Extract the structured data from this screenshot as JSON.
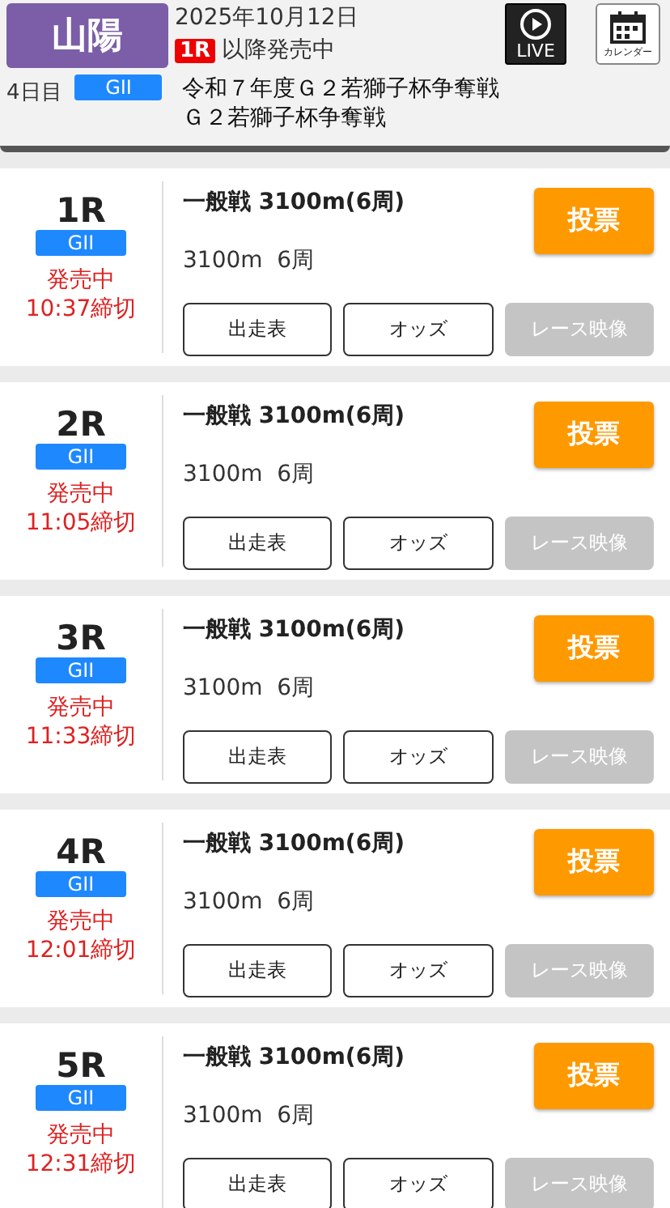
{
  "header": {
    "venue": "山陽",
    "date": "2025年10月12日",
    "start_race": "1R",
    "sale_status": "以降発売中",
    "day": "4日目",
    "grade": "GII",
    "title_lines": [
      "令和７年度Ｇ２若獅子杯争奪戦",
      "Ｇ２若獅子杯争奪戦"
    ],
    "live_label": "LIVE",
    "calendar_label": "カレンダー"
  },
  "races": [
    {
      "number": "1R",
      "grade": "GII",
      "status": "発売中",
      "deadline": "10:37締切",
      "name": "一般戦 3100m(6周)",
      "distance": "3100m  6周",
      "vote": "投票",
      "buttons": [
        {
          "label": "出走表",
          "disabled": false
        },
        {
          "label": "オッズ",
          "disabled": false
        },
        {
          "label": "レース映像",
          "disabled": true
        }
      ]
    },
    {
      "number": "2R",
      "grade": "GII",
      "status": "発売中",
      "deadline": "11:05締切",
      "name": "一般戦 3100m(6周)",
      "distance": "3100m  6周",
      "vote": "投票",
      "buttons": [
        {
          "label": "出走表",
          "disabled": false
        },
        {
          "label": "オッズ",
          "disabled": false
        },
        {
          "label": "レース映像",
          "disabled": true
        }
      ]
    },
    {
      "number": "3R",
      "grade": "GII",
      "status": "発売中",
      "deadline": "11:33締切",
      "name": "一般戦 3100m(6周)",
      "distance": "3100m  6周",
      "vote": "投票",
      "buttons": [
        {
          "label": "出走表",
          "disabled": false
        },
        {
          "label": "オッズ",
          "disabled": false
        },
        {
          "label": "レース映像",
          "disabled": true
        }
      ]
    },
    {
      "number": "4R",
      "grade": "GII",
      "status": "発売中",
      "deadline": "12:01締切",
      "name": "一般戦 3100m(6周)",
      "distance": "3100m  6周",
      "vote": "投票",
      "buttons": [
        {
          "label": "出走表",
          "disabled": false
        },
        {
          "label": "オッズ",
          "disabled": false
        },
        {
          "label": "レース映像",
          "disabled": true
        }
      ]
    },
    {
      "number": "5R",
      "grade": "GII",
      "status": "発売中",
      "deadline": "12:31締切",
      "name": "一般戦 3100m(6周)",
      "distance": "3100m  6周",
      "vote": "投票",
      "buttons": [
        {
          "label": "出走表",
          "disabled": false
        },
        {
          "label": "オッズ",
          "disabled": false
        },
        {
          "label": "レース映像",
          "disabled": true
        }
      ]
    }
  ]
}
